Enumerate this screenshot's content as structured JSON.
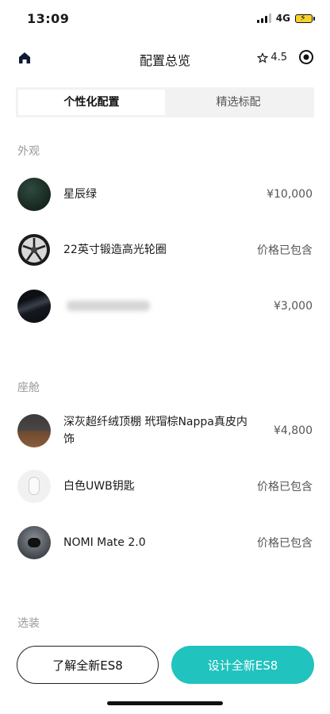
{
  "status": {
    "time": "13:09",
    "network": "4G"
  },
  "nav": {
    "title": "配置总览",
    "rating": "4.5"
  },
  "tabs": [
    {
      "label": "个性化配置",
      "active": true
    },
    {
      "label": "精选标配",
      "active": false
    }
  ],
  "exterior": {
    "title": "外观",
    "items": [
      {
        "name": "星辰绿",
        "price": "¥10,000",
        "icon": "green-paint-swatch"
      },
      {
        "name": "22英寸锻造高光轮圈",
        "price": "价格已包含",
        "icon": "wheel-rim"
      },
      {
        "name": "",
        "price": "¥3,000",
        "icon": "dark-roof-swatch"
      }
    ]
  },
  "cabin": {
    "title": "座舱",
    "items": [
      {
        "name": "深灰超纤绒顶棚 玳瑁棕Nappa真皮内饰",
        "price": "¥4,800",
        "icon": "interior-swatch"
      },
      {
        "name": "白色UWB钥匙",
        "price": "价格已包含",
        "icon": "uwb-key"
      },
      {
        "name": "NOMI Mate 2.0",
        "price": "价格已包含",
        "icon": "nomi-device"
      }
    ]
  },
  "options": {
    "title": "选装"
  },
  "footer": {
    "learn_label": "了解全新ES8",
    "design_label": "设计全新ES8"
  },
  "colors": {
    "accent": "#20c3be"
  }
}
